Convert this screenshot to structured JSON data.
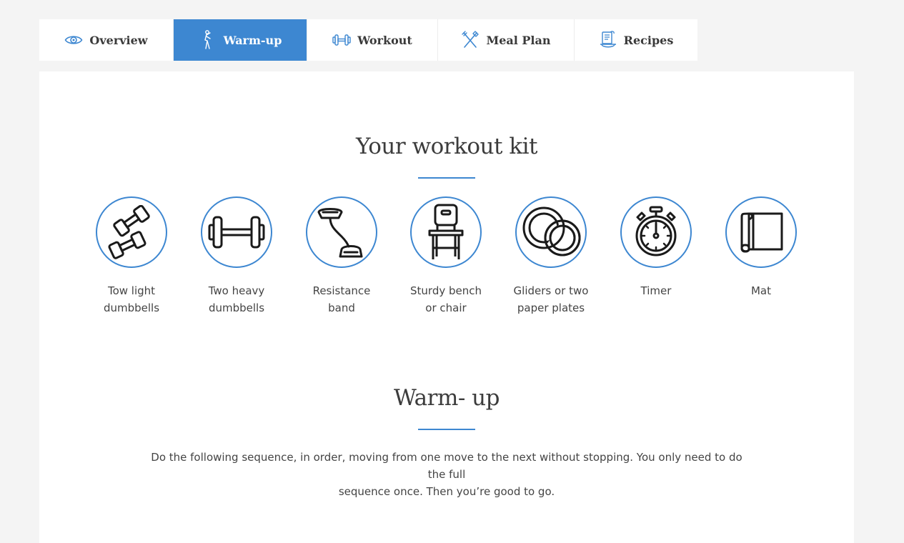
{
  "tabs": [
    {
      "label": "Overview",
      "icon": "eye-icon",
      "active": false
    },
    {
      "label": "Warm-up",
      "icon": "stretching-person-icon",
      "active": true
    },
    {
      "label": "Workout",
      "icon": "dumbbell-icon",
      "active": false
    },
    {
      "label": "Meal Plan",
      "icon": "fork-knife-icon",
      "active": false
    },
    {
      "label": "Recipes",
      "icon": "recipe-book-icon",
      "active": false
    }
  ],
  "kit": {
    "title": "Your workout kit",
    "items": [
      {
        "line1": "Tow light",
        "line2": "dumbbells",
        "icon": "light-dumbbells-icon"
      },
      {
        "line1": "Two heavy",
        "line2": "dumbbells",
        "icon": "heavy-dumbbell-icon"
      },
      {
        "line1": "Resistance",
        "line2": "band",
        "icon": "resistance-band-icon"
      },
      {
        "line1": "Sturdy bench",
        "line2": "or chair",
        "icon": "chair-icon"
      },
      {
        "line1": "Gliders or two",
        "line2": "paper plates",
        "icon": "paper-plates-icon"
      },
      {
        "line1": "Timer",
        "line2": "",
        "icon": "stopwatch-icon"
      },
      {
        "line1": "Mat",
        "line2": "",
        "icon": "mat-icon"
      }
    ]
  },
  "warmup": {
    "title": "Warm- up",
    "line1": "Do the following sequence, in order, moving from one move to the next without stopping. You only need to do the full",
    "line2": "sequence once. Then you’re good to go."
  },
  "colors": {
    "accent": "#3d87d1",
    "text": "#444444",
    "background": "#f4f4f4",
    "card": "#ffffff"
  }
}
